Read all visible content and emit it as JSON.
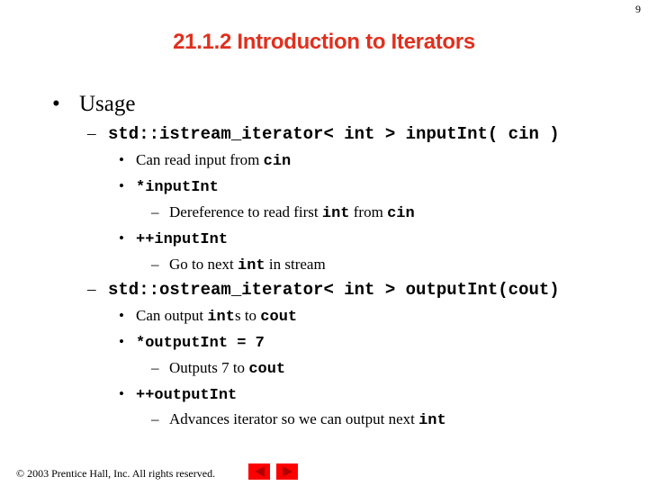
{
  "page_number": "9",
  "title": "21.1.2 Introduction to Iterators",
  "colors": {
    "title": "#e0301e",
    "nav_button": "#ff0000",
    "nav_arrow": "#b00000"
  },
  "bullets": {
    "usage": "Usage",
    "istream_decl": "std::istream_iterator< int > inputInt( cin )",
    "can_read_pre": "Can read input from ",
    "can_read_code": "cin",
    "deref_input": "*inputInt",
    "deref_desc_pre": "Dereference to read first ",
    "deref_desc_code1": "int",
    "deref_desc_mid": " from ",
    "deref_desc_code2": "cin",
    "inc_input": "++inputInt",
    "inc_input_desc_pre": "Go to next ",
    "inc_input_desc_code": "int",
    "inc_input_desc_post": " in stream",
    "ostream_decl": "std::ostream_iterator< int > outputInt(cout)",
    "can_output_pre": "Can output ",
    "can_output_code1": "int",
    "can_output_mid": "s to ",
    "can_output_code2": "cout",
    "assign_output": "*outputInt = 7",
    "assign_desc_pre": "Outputs 7 to ",
    "assign_desc_code": "cout",
    "inc_output": "++outputInt",
    "inc_output_desc_pre": "Advances iterator so we can output next ",
    "inc_output_desc_code": "int"
  },
  "glyphs": {
    "bullet": "•",
    "dash": "–"
  },
  "footer": {
    "copyright": "© 2003 Prentice Hall, Inc.  All rights reserved."
  },
  "nav": {
    "prev_icon": "triangle-left",
    "next_icon": "triangle-right"
  }
}
